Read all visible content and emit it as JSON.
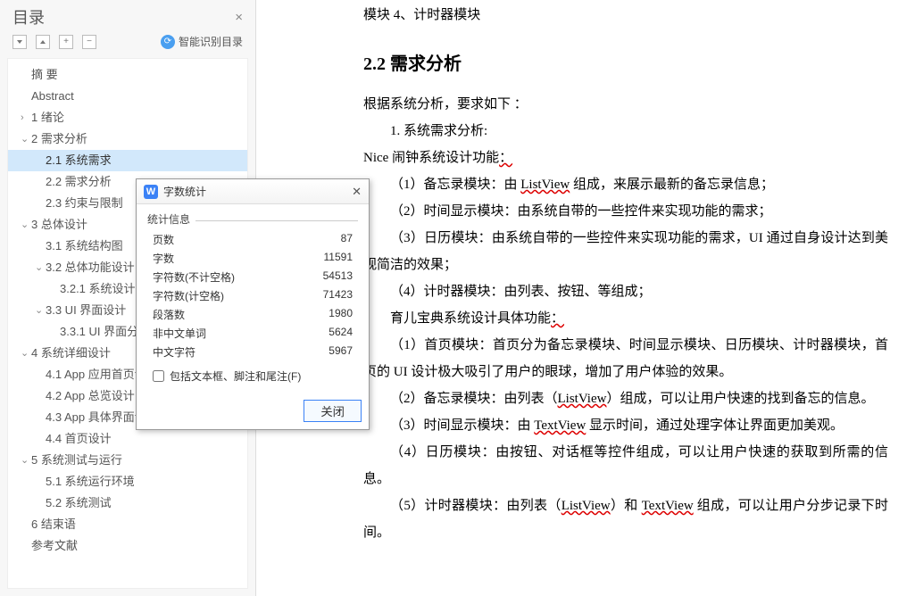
{
  "sidebar": {
    "title": "目录",
    "smart_toc_label": "智能识别目录"
  },
  "toc": [
    {
      "level": 0,
      "caret": "",
      "label": "摘  要",
      "selected": false
    },
    {
      "level": 0,
      "caret": "",
      "label": "Abstract",
      "selected": false
    },
    {
      "level": 0,
      "caret": ">",
      "label": "1 绪论",
      "selected": false
    },
    {
      "level": 0,
      "caret": "v",
      "label": "2 需求分析",
      "selected": false
    },
    {
      "level": 1,
      "caret": "",
      "label": "2.1 系统需求",
      "selected": true
    },
    {
      "level": 1,
      "caret": "",
      "label": "2.2 需求分析",
      "selected": false
    },
    {
      "level": 1,
      "caret": "",
      "label": "2.3 约束与限制",
      "selected": false
    },
    {
      "level": 0,
      "caret": "v",
      "label": "3 总体设计",
      "selected": false
    },
    {
      "level": 1,
      "caret": "",
      "label": "3.1 系统结构图",
      "selected": false
    },
    {
      "level": 1,
      "caret": "v",
      "label": "3.2 总体功能设计",
      "selected": false
    },
    {
      "level": 2,
      "caret": "",
      "label": "3.2.1 系统设计目",
      "selected": false
    },
    {
      "level": 1,
      "caret": "v",
      "label": "3.3 UI 界面设计",
      "selected": false
    },
    {
      "level": 2,
      "caret": "",
      "label": "3.3.1 UI 界面分析",
      "selected": false
    },
    {
      "level": 0,
      "caret": "v",
      "label": "4 系统详细设计",
      "selected": false
    },
    {
      "level": 1,
      "caret": "",
      "label": "4.1 App 应用首页设",
      "selected": false
    },
    {
      "level": 1,
      "caret": "",
      "label": "4.2 App 总览设计",
      "selected": false
    },
    {
      "level": 1,
      "caret": "",
      "label": "4.3 App 具体界面设",
      "selected": false
    },
    {
      "level": 1,
      "caret": "",
      "label": "4.4 首页设计",
      "selected": false
    },
    {
      "level": 0,
      "caret": "v",
      "label": "5 系统测试与运行",
      "selected": false
    },
    {
      "level": 1,
      "caret": "",
      "label": "5.1 系统运行环境",
      "selected": false
    },
    {
      "level": 1,
      "caret": "",
      "label": "5.2 系统测试",
      "selected": false
    },
    {
      "level": 0,
      "caret": "",
      "label": "6 结束语",
      "selected": false
    },
    {
      "level": 0,
      "caret": "",
      "label": "参考文献",
      "selected": false
    }
  ],
  "doc": {
    "top_line": "模块 4、计时器模块",
    "heading": "2.2 需求分析",
    "p_intro": "根据系统分析，要求如下 ：",
    "p_1": "1.  系统需求分析:",
    "p_nice_prefix": "Nice 闹钟系统设计功能",
    "p_colon": "：",
    "li_1_a": "（1）备忘录模块：由 ",
    "li_1_b": "ListView",
    "li_1_c": " 组成，来展示最新的备忘录信息；",
    "li_2": "（2）时间显示模块：由系统自带的一些控件来实现功能的需求；",
    "li_3": "（3）日历模块：由系统自带的一些控件来实现功能的需求，UI 通过自身设计达到美观简洁的效果；",
    "li_4": "（4）计时器模块：由列表、按钮、等组成；",
    "subhead": "育儿宝典系统设计具体功能",
    "sl_1": "（1）首页模块：首页分为备忘录模块、时间显示模块、日历模块、计时器模块，首页的 UI 设计极大吸引了用户的眼球，增加了用户体验的效果。",
    "sl_2_a": "（2）备忘录模块：由列表（",
    "sl_2_b": "ListView",
    "sl_2_c": "）组成，可以让用户快速的找到备忘的信息。",
    "sl_3_a": "（3）时间显示模块：由 ",
    "sl_3_b": "TextView",
    "sl_3_c": " 显示时间，通过处理字体让界面更加美观。",
    "sl_4": "（4）日历模块：由按钮、对话框等控件组成，可以让用户快速的获取到所需的信息。",
    "sl_5_a": "（5）计时器模块：由列表（",
    "sl_5_b": "ListView",
    "sl_5_c": "）和 ",
    "sl_5_d": "TextView",
    "sl_5_e": " 组成，可以让用户分步记录下时间。"
  },
  "dialog": {
    "title": "字数统计",
    "section_label": "统计信息",
    "stats": [
      {
        "label": "页数",
        "value": "87"
      },
      {
        "label": "字数",
        "value": "11591"
      },
      {
        "label": "字符数(不计空格)",
        "value": "54513"
      },
      {
        "label": "字符数(计空格)",
        "value": "71423"
      },
      {
        "label": "段落数",
        "value": "1980"
      },
      {
        "label": "非中文单词",
        "value": "5624"
      },
      {
        "label": "中文字符",
        "value": "5967"
      }
    ],
    "checkbox_label": "包括文本框、脚注和尾注(F)",
    "close_button": "关闭"
  }
}
